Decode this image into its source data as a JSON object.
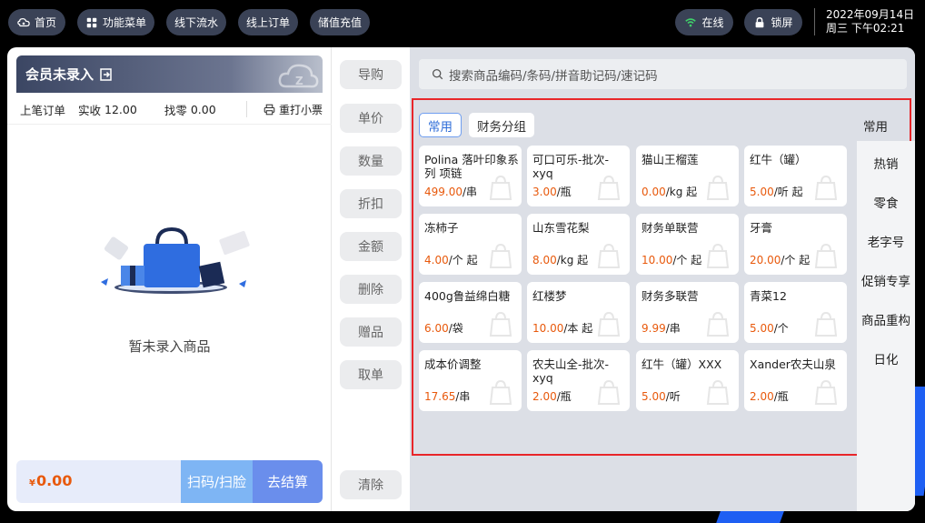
{
  "topbar": {
    "home": "首页",
    "menu": "功能菜单",
    "offline_flow": "线下流水",
    "online_order": "线上订单",
    "recharge": "储值充值",
    "online_status": "在线",
    "lock": "锁屏",
    "date": "2022年09月14日",
    "weekday_time": "周三 下午02:21"
  },
  "cart": {
    "member_label": "会员未录入",
    "last_order": "上笔订单",
    "received_label": "实收",
    "received_value": "12.00",
    "change_label": "找零",
    "change_value": "0.00",
    "reprint": "重打小票",
    "empty_text": "暂未录入商品",
    "currency": "¥",
    "total": "0.00",
    "scan_button": "扫码/扫脸",
    "pay_button": "去结算"
  },
  "actions": [
    "导购",
    "单价",
    "数量",
    "折扣",
    "金额",
    "删除",
    "赠品",
    "取单"
  ],
  "clear_button": "清除",
  "goods": {
    "search_placeholder": "搜索商品编码/条码/拼音助记码/速记码",
    "tabs": [
      {
        "label": "常用",
        "active": true
      },
      {
        "label": "财务分组",
        "active": false
      }
    ],
    "category_title": "常用",
    "categories": [
      "热销",
      "零食",
      "老字号",
      "促销专享",
      "商品重构",
      "日化"
    ],
    "products": [
      {
        "name": "Polina 落叶印象系列 项链",
        "price": "499.00",
        "unit": "/串"
      },
      {
        "name": "可口可乐-批次-xyq",
        "price": "3.00",
        "unit": "/瓶"
      },
      {
        "name": "猫山王榴莲",
        "price": "0.00",
        "unit": "/kg 起"
      },
      {
        "name": "红牛（罐）",
        "price": "5.00",
        "unit": "/听 起"
      },
      {
        "name": "冻柿子",
        "price": "4.00",
        "unit": "/个 起"
      },
      {
        "name": "山东雪花梨",
        "price": "8.00",
        "unit": "/kg 起"
      },
      {
        "name": "财务单联营",
        "price": "10.00",
        "unit": "/个 起"
      },
      {
        "name": "牙膏",
        "price": "20.00",
        "unit": "/个 起"
      },
      {
        "name": "400g鲁益绵白糖",
        "price": "6.00",
        "unit": "/袋"
      },
      {
        "name": "红楼梦",
        "price": "10.00",
        "unit": "/本 起"
      },
      {
        "name": "财务多联营",
        "price": "9.99",
        "unit": "/串"
      },
      {
        "name": "青菜12",
        "price": "5.00",
        "unit": "/个"
      },
      {
        "name": "成本价调整",
        "price": "17.65",
        "unit": "/串"
      },
      {
        "name": "农夫山全-批次-xyq",
        "price": "2.00",
        "unit": "/瓶"
      },
      {
        "name": "红牛（罐）XXX",
        "price": "5.00",
        "unit": "/听"
      },
      {
        "name": "Xander农夫山泉",
        "price": "2.00",
        "unit": "/瓶"
      }
    ]
  },
  "colors": {
    "accent_blue": "#1e5ff3",
    "price_orange": "#e8590c",
    "highlight_red": "#e8262a",
    "pill_bg": "#3a4256"
  },
  "icons": [
    "home-icon",
    "grid-icon",
    "wifi-icon",
    "lock-icon",
    "exit-icon",
    "printer-icon",
    "search-icon",
    "bag-icon"
  ]
}
